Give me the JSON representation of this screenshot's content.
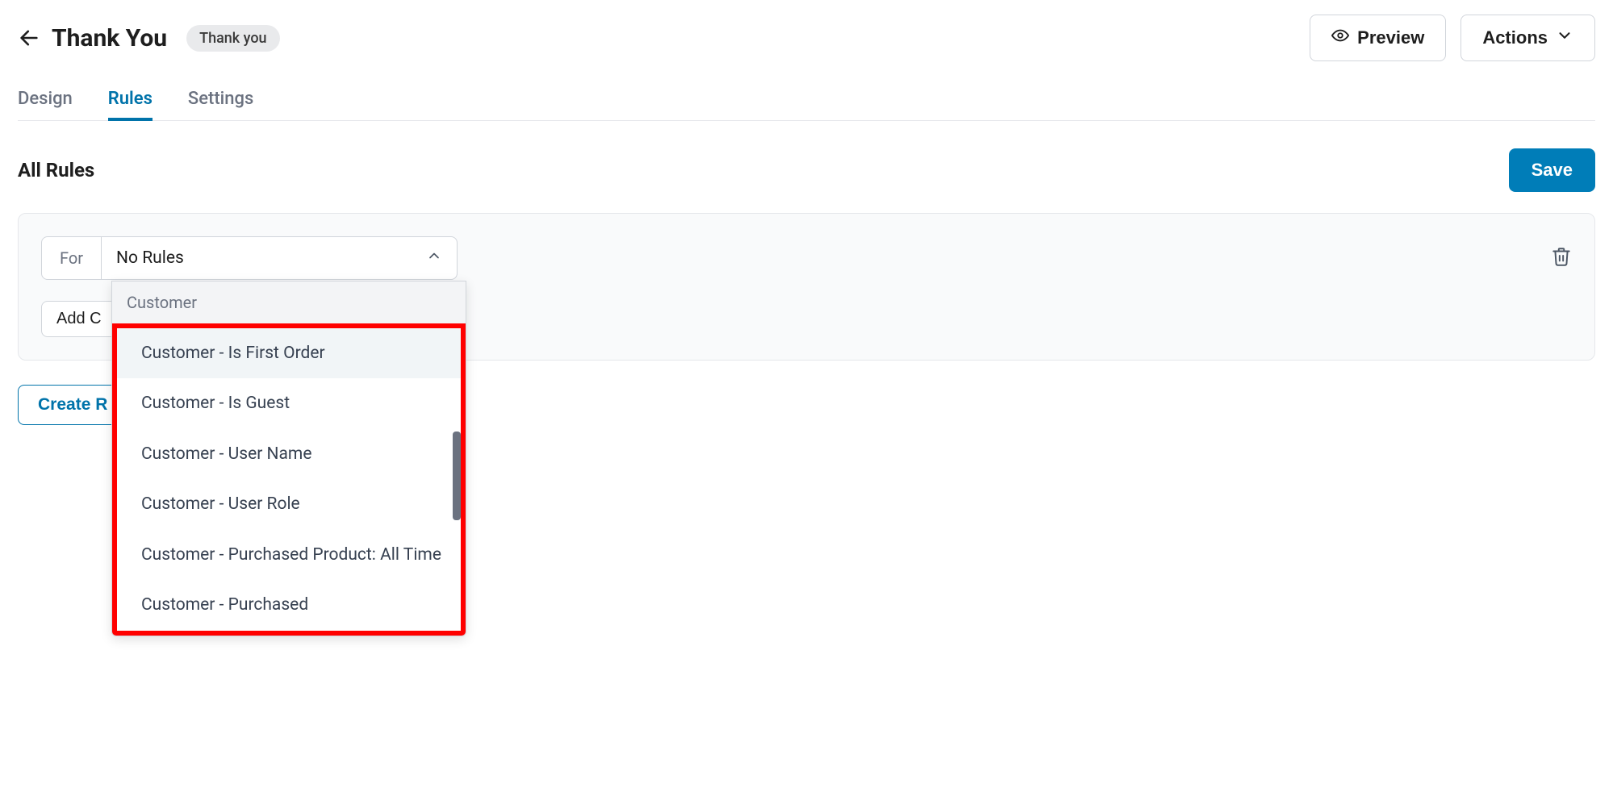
{
  "header": {
    "title": "Thank You",
    "badge": "Thank you",
    "preview_label": "Preview",
    "actions_label": "Actions"
  },
  "tabs": {
    "design": "Design",
    "rules": "Rules",
    "settings": "Settings"
  },
  "section": {
    "title": "All Rules",
    "save_label": "Save"
  },
  "rule": {
    "for_label": "For",
    "select_value": "No Rules",
    "add_condition_label": "Add C",
    "dropdown": {
      "group_label": "Customer",
      "items": [
        "Customer - Is First Order",
        "Customer - Is Guest",
        "Customer - User Name",
        "Customer - User Role",
        "Customer - Purchased Product: All Time",
        "Customer - Purchased"
      ]
    }
  },
  "create_rules_label": "Create R"
}
